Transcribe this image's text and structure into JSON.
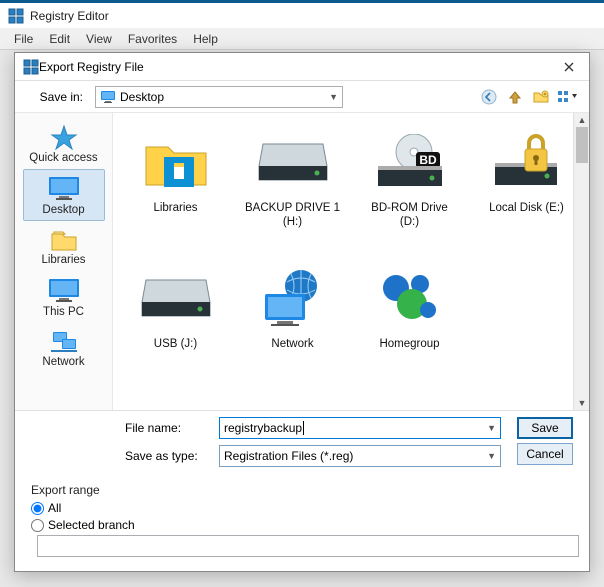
{
  "parent_window": {
    "title": "Registry Editor"
  },
  "menu": {
    "file": "File",
    "edit": "Edit",
    "view": "View",
    "favorites": "Favorites",
    "help": "Help"
  },
  "dialog": {
    "title": "Export Registry File",
    "savein_label": "Save in:",
    "savein_value": "Desktop",
    "places": {
      "quick": "Quick access",
      "desktop": "Desktop",
      "libraries": "Libraries",
      "thispc": "This PC",
      "network": "Network"
    },
    "items": {
      "libraries": "Libraries",
      "backup": "BACKUP DRIVE 1 (H:)",
      "bdrom": "BD-ROM Drive (D:)",
      "local_e": "Local Disk (E:)",
      "usb": "USB (J:)",
      "network": "Network",
      "homegroup": "Homegroup"
    },
    "filename_label": "File name:",
    "filename_value": "registrybackup",
    "saveas_label": "Save as type:",
    "saveas_value": "Registration Files (*.reg)",
    "save_btn": "Save",
    "cancel_btn": "Cancel",
    "export_range_legend": "Export range",
    "export_all": "All",
    "export_selected": "Selected branch"
  }
}
